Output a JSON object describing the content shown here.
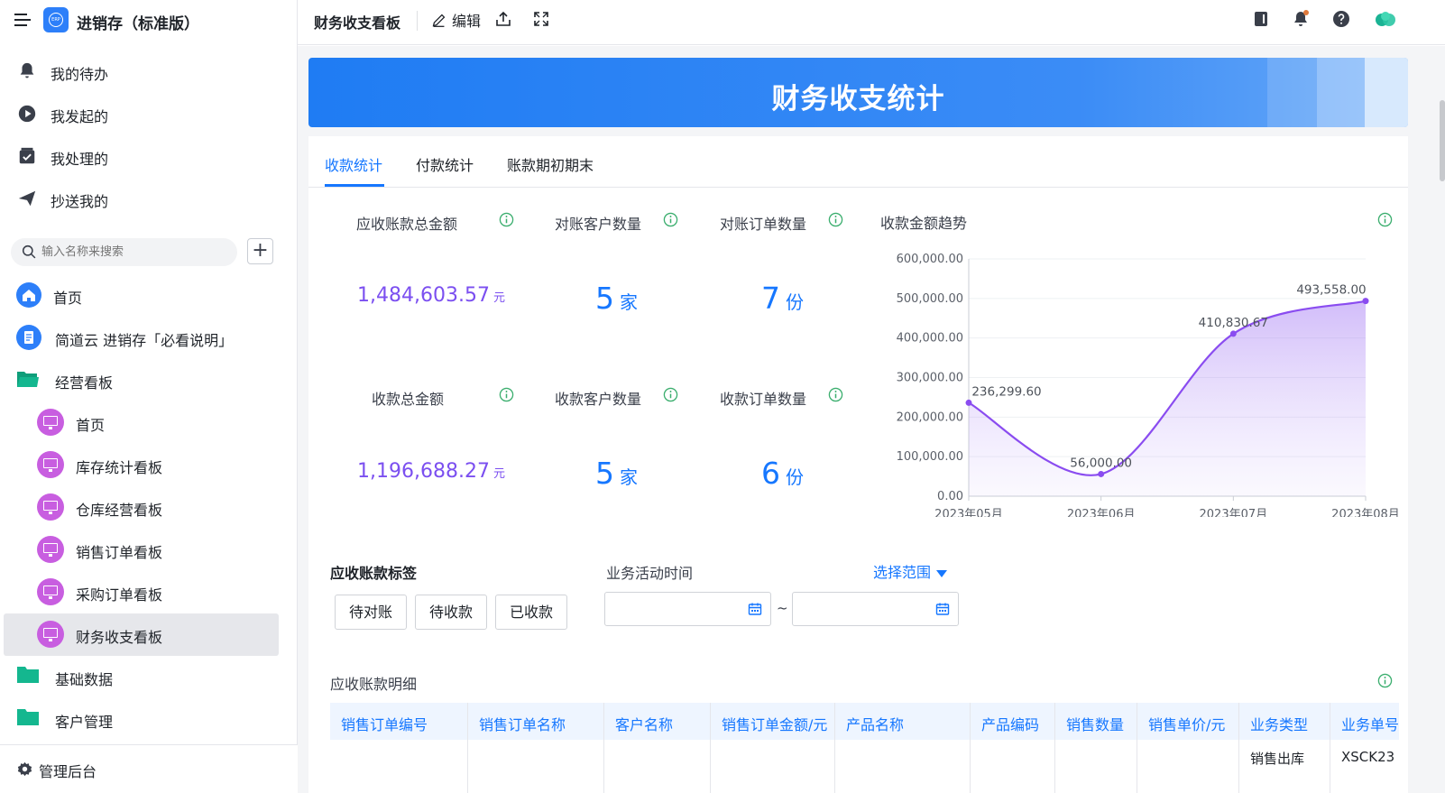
{
  "app": {
    "name": "进销存（标准版）",
    "logo_text": "ERP"
  },
  "sidebar": {
    "quick": [
      {
        "label": "我的待办",
        "icon": "bell-icon"
      },
      {
        "label": "我发起的",
        "icon": "play-circle-icon"
      },
      {
        "label": "我处理的",
        "icon": "check-square-icon"
      },
      {
        "label": "抄送我的",
        "icon": "paper-plane-icon"
      }
    ],
    "search_placeholder": "输入名称来搜索",
    "add_label": "+",
    "tree": [
      {
        "label": "首页",
        "icon": "home-icon"
      },
      {
        "label": "简道云 进销存「必看说明」",
        "icon": "document-icon"
      },
      {
        "label": "经营看板",
        "icon": "folder-open-icon"
      },
      {
        "label": "首页",
        "icon": "dashboard-icon"
      },
      {
        "label": "库存统计看板",
        "icon": "dashboard-icon"
      },
      {
        "label": "仓库经营看板",
        "icon": "dashboard-icon"
      },
      {
        "label": "销售订单看板",
        "icon": "dashboard-icon"
      },
      {
        "label": "采购订单看板",
        "icon": "dashboard-icon"
      },
      {
        "label": "财务收支看板",
        "icon": "dashboard-icon",
        "active": true
      },
      {
        "label": "基础数据",
        "icon": "folder-icon"
      },
      {
        "label": "客户管理",
        "icon": "folder-icon"
      }
    ],
    "footer_label": "管理后台"
  },
  "topbar": {
    "title": "财务收支看板",
    "edit_label": "编辑"
  },
  "banner": {
    "title": "财务收支统计"
  },
  "tabs": [
    {
      "label": "收款统计",
      "active": true
    },
    {
      "label": "付款统计"
    },
    {
      "label": "账款期初期末"
    }
  ],
  "stats": {
    "receivable_total": {
      "label": "应收账款总金额",
      "value": "1,484,603.57",
      "unit": "元"
    },
    "recon_customers": {
      "label": "对账客户数量",
      "value": "5",
      "unit": "家"
    },
    "recon_orders": {
      "label": "对账订单数量",
      "value": "7",
      "unit": "份"
    },
    "received_total": {
      "label": "收款总金额",
      "value": "1,196,688.27",
      "unit": "元"
    },
    "received_customers": {
      "label": "收款客户数量",
      "value": "5",
      "unit": "家"
    },
    "received_orders": {
      "label": "收款订单数量",
      "value": "6",
      "unit": "份"
    }
  },
  "chart_data": {
    "type": "area",
    "title": "收款金额趋势",
    "categories": [
      "2023年05月",
      "2023年06月",
      "2023年07月",
      "2023年08月"
    ],
    "series": [
      {
        "values": [
          236299.6,
          56000.0,
          410830.67,
          493558.0
        ]
      }
    ],
    "value_labels": [
      "236,299.60",
      "56,000.00",
      "410,830.67",
      "493,558.00"
    ],
    "yticks": [
      "0.00",
      "100,000.00",
      "200,000.00",
      "300,000.00",
      "400,000.00",
      "500,000.00",
      "600,000.00"
    ],
    "ylim": [
      0,
      600000
    ],
    "grid": true,
    "color": "#8a4cf0"
  },
  "filters": {
    "tag_section_label": "应收账款标签",
    "tags": [
      "待对账",
      "待收款",
      "已收款"
    ],
    "time_label": "业务活动时间",
    "range_label": "选择范围",
    "range_separator": "~"
  },
  "detail": {
    "title": "应收账款明细",
    "columns": [
      "销售订单编号",
      "销售订单名称",
      "客户名称",
      "销售订单金额/元",
      "产品名称",
      "产品编码",
      "销售数量",
      "销售单价/元",
      "业务类型",
      "业务单号"
    ],
    "first_row": {
      "business_type": "销售出库",
      "business_no": "XSCK23"
    }
  },
  "colors": {
    "accent": "#1677ff",
    "money": "#7b4ff0",
    "sidebar_icon": "#c85ee0",
    "folder": "#14b78f",
    "banner": "#1f7cf3"
  }
}
